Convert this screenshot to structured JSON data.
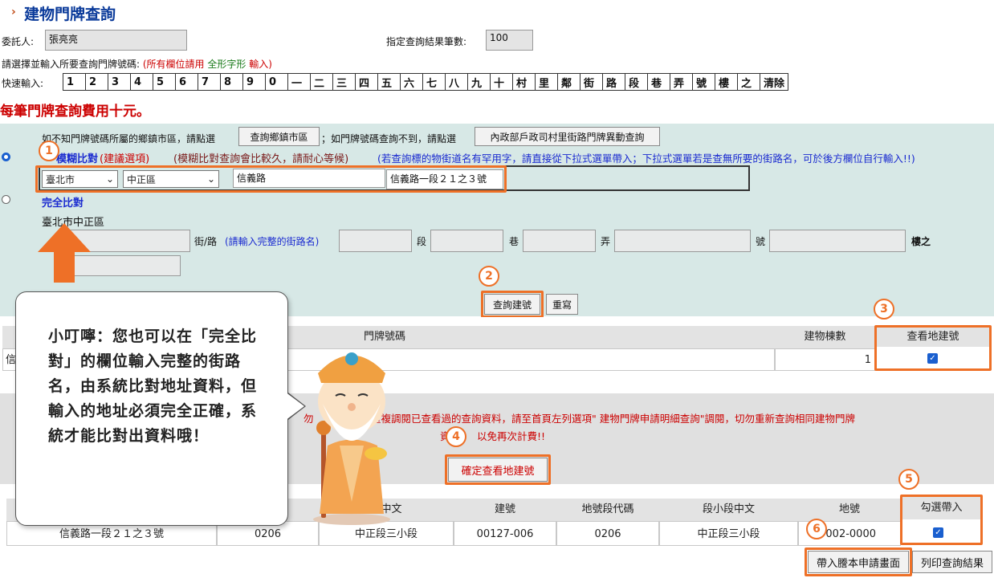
{
  "header": {
    "title": "建物門牌查詢"
  },
  "form": {
    "client_label": "委託人:",
    "client_value": "張亮亮",
    "result_count_label": "指定查詢結果筆數:",
    "result_count_value": "100",
    "instruction_prefix": "請選擇並輸入所要查詢門牌號碼:",
    "instruction_red": "(所有欄位請用",
    "instruction_green": "全形字形",
    "instruction_tail": "輸入)",
    "quick_label": "快速輸入:",
    "quick_keys": [
      "1",
      "2",
      "3",
      "4",
      "5",
      "6",
      "7",
      "8",
      "9",
      "0",
      "一",
      "二",
      "三",
      "四",
      "五",
      "六",
      "七",
      "八",
      "九",
      "十",
      "村",
      "里",
      "鄰",
      "街",
      "路",
      "段",
      "巷",
      "弄",
      "號",
      "樓",
      "之",
      "清除"
    ],
    "fee_notice": "每筆門牌查詢費用十元。"
  },
  "search": {
    "hint1": "如不知門牌號碼所屬的鄉鎮市區，請點選",
    "btn_query_town": "查詢鄉鎮市區",
    "hint2": "；如門牌號碼查詢不到，請點選",
    "btn_moi": "內政部戶政司村里街路門牌異動查詢",
    "fuzzy_label": "模糊比對",
    "fuzzy_rec": "(建議選項)",
    "fuzzy_note": "(模糊比對查詢會比較久，請耐心等候)",
    "fuzzy_note_blue": "(若查詢標的物街道名有罕用字，請直接從下拉式選單帶入；下拉式選單若是查無所要的街路名，可於後方欄位自行輸入!!)",
    "city": "臺北市",
    "district": "中正區",
    "road": "信義路",
    "address": "信義路一段２１之３號",
    "exact_label": "完全比對",
    "exact_area": "臺北市中正區",
    "street_label": "街/路",
    "street_hint": "(請輸入完整的街路名)",
    "sec_label": "段",
    "lane_label": "巷",
    "alley_label": "弄",
    "no_label": "號",
    "floor_label": "樓之",
    "btn_search": "查詢建號",
    "btn_reset": "重寫"
  },
  "result1": {
    "col_addr": "門牌號碼",
    "col_count": "建物棟數",
    "col_view": "查看地建號",
    "row_prefix": "信",
    "row_count": "1"
  },
  "warning": {
    "text_a": "重複調閱已查看過的查詢資料，請至首頁左列選項\" 建物門牌申請明細查詢\"調閱，切勿重新查詢相同建物門牌",
    "text_b": "以免再次計費!!",
    "text_left": "勿",
    "text_b_prefix": "資",
    "btn_confirm": "確定查看地建號"
  },
  "result2": {
    "headers": [
      "碼",
      "段中文",
      "建號",
      "地號段代碼",
      "段小段中文",
      "地號",
      "勾選帶入"
    ],
    "row": [
      "信義路一段２１之３號",
      "0206",
      "中正段三小段",
      "00127-006",
      "0206",
      "中正段三小段",
      "002-0000"
    ],
    "btn_bring": "帶入謄本申請畫面",
    "btn_print": "列印查詢結果"
  },
  "bubble": {
    "text": "小叮嚀：您也可以在「完全比對」的欄位輸入完整的街路名，由系統比對地址資料，但輸入的地址必須完全正確，系統才能比對出資料哦！"
  },
  "badges": [
    "1",
    "2",
    "3",
    "4",
    "5",
    "6"
  ],
  "colors": {
    "accent": "#ee7027",
    "title": "#0a3a9a",
    "panel": "#d7e8e6"
  }
}
